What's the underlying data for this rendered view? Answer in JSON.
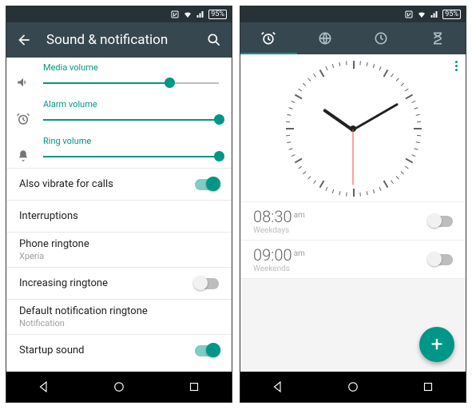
{
  "status": {
    "battery": "95%"
  },
  "settings": {
    "title": "Sound & notification",
    "sliders": {
      "media": {
        "label": "Media volume",
        "value": 0.72
      },
      "alarm": {
        "label": "Alarm volume",
        "value": 1.0
      },
      "ring": {
        "label": "Ring volume",
        "value": 1.0
      }
    },
    "vibrate_label": "Also vibrate for calls",
    "vibrate_on": true,
    "interruptions_label": "Interruptions",
    "ringtone_label": "Phone ringtone",
    "ringtone_value": "Xperia",
    "increasing_label": "Increasing ringtone",
    "increasing_on": false,
    "default_notif_label": "Default notification ringtone",
    "default_notif_value": "Notification",
    "startup_label": "Startup sound",
    "startup_on": true
  },
  "clock": {
    "time": {
      "hour": 10,
      "minute": 10,
      "second": 30
    },
    "alarms": [
      {
        "time": "08:30",
        "ampm": "am",
        "days": "Weekdays",
        "on": false
      },
      {
        "time": "09:00",
        "ampm": "am",
        "days": "Weekends",
        "on": false
      }
    ]
  }
}
